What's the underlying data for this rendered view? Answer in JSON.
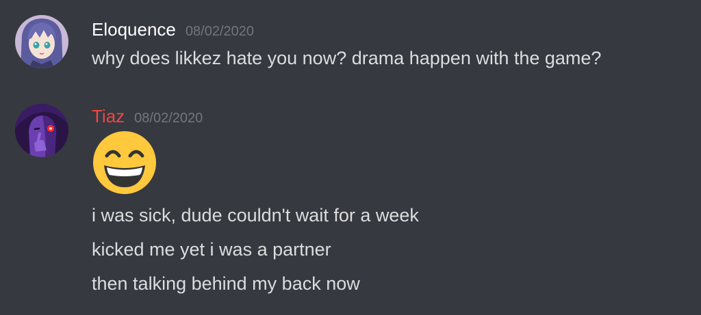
{
  "messages": [
    {
      "username": "Eloquence",
      "username_color": "#ffffff",
      "timestamp": "08/02/2020",
      "avatar_icon": "anime-girl-avatar-icon",
      "lines": [
        "why does likkez hate you now? drama happen with the game?"
      ]
    },
    {
      "username": "Tiaz",
      "username_color": "#f04747",
      "timestamp": "08/02/2020",
      "avatar_icon": "purple-character-avatar-icon",
      "emoji": "grinning-face-with-smiling-eyes-emoji",
      "lines": [
        "i was sick, dude couldn't wait for a week",
        "kicked me yet i was a partner",
        "then talking behind my back now"
      ]
    }
  ],
  "colors": {
    "background": "#36393f",
    "text": "#dcddde",
    "timestamp": "#72767d"
  }
}
